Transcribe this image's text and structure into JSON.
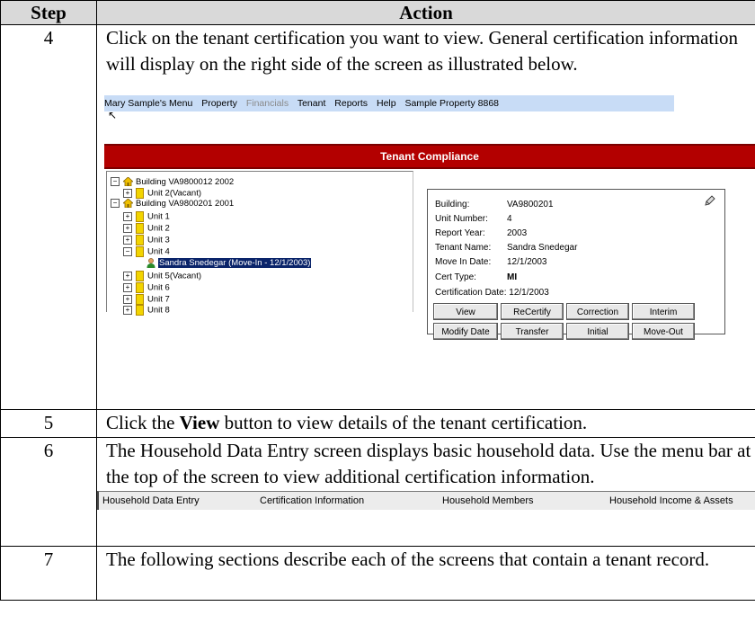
{
  "table": {
    "header_step": "Step",
    "header_action": "Action",
    "rows": [
      {
        "step": "4",
        "text": "Click on the tenant certification you want to view. General certification information will display on the right side of the screen as illustrated below."
      },
      {
        "step": "5",
        "text_before": "Click the ",
        "text_bold": "View",
        "text_after": " button to view details of the tenant certification."
      },
      {
        "step": "6",
        "text": "The Household Data Entry screen displays basic household data. Use the menu bar at the top of the screen to view additional certification information."
      },
      {
        "step": "7",
        "text": "The following sections describe each of the screens that contain a tenant record."
      }
    ]
  },
  "screenshot1": {
    "menu": [
      "Mary Sample's Menu",
      "Property",
      "Financials",
      "Tenant",
      "Reports",
      "Help",
      "Sample Property 8868"
    ],
    "disabled_item": "Financials",
    "title": "Tenant Compliance",
    "tree": [
      "Building VA9800012 2002",
      "Unit 2(Vacant)",
      "Building VA9800201 2001",
      "Unit 1",
      "Unit 2",
      "Unit 3",
      "Unit 4",
      "Sandra Snedegar (Move-In - 12/1/2003)",
      "Unit 5(Vacant)",
      "Unit 6",
      "Unit 7",
      "Unit 8"
    ],
    "info": {
      "building_label": "Building:",
      "building_value": "VA9800201",
      "unit_label": "Unit Number:",
      "unit_value": "4",
      "year_label": "Report Year:",
      "year_value": "2003",
      "tenant_label": "Tenant Name:",
      "tenant_value": "Sandra Snedegar",
      "movein_label": "Move In Date:",
      "movein_value": "12/1/2003",
      "cert_label": "Cert Type:",
      "cert_value": "MI",
      "certdate_label": "Certification Date:",
      "certdate_value": "12/1/2003"
    },
    "buttons_row1": [
      "View",
      "ReCertify",
      "Correction",
      "Interim"
    ],
    "buttons_row2": [
      "Modify Date",
      "Transfer",
      "Initial",
      "Move-Out"
    ]
  },
  "screenshot2": {
    "menu": [
      "Household Data Entry",
      "Certification Information",
      "Household Members",
      "Household Income & Assets"
    ]
  },
  "colors": {
    "menu_bg": "#c8dcf6",
    "title_bar": "#b30000",
    "selection": "#0a246a",
    "header_bg": "#d9d9d9"
  }
}
